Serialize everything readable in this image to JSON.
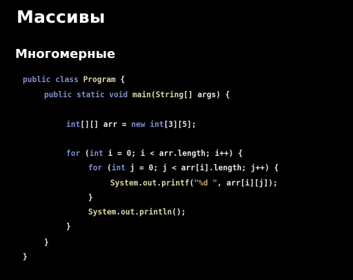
{
  "slide": {
    "title": "Массивы",
    "subtitle": "Многомерные"
  },
  "code": {
    "lines": [
      [
        [
          "kw",
          "public class "
        ],
        [
          "cls",
          "Program"
        ],
        [
          "plain",
          " {"
        ]
      ],
      [
        [
          "kw",
          "public static void "
        ],
        [
          "cls",
          "main"
        ],
        [
          "plain",
          "("
        ],
        [
          "cls",
          "String"
        ],
        [
          "plain",
          "[] args) {"
        ]
      ],
      [
        [
          "kw",
          "int"
        ],
        [
          "plain",
          "[][] arr = "
        ],
        [
          "kw",
          "new int"
        ],
        [
          "plain",
          "[3][5];"
        ]
      ],
      [
        [
          "kw",
          "for "
        ],
        [
          "plain",
          "("
        ],
        [
          "kw",
          "int "
        ],
        [
          "plain",
          "i = 0; i < arr.length; i++) {"
        ]
      ],
      [
        [
          "kw",
          "for "
        ],
        [
          "plain",
          "("
        ],
        [
          "kw",
          "int "
        ],
        [
          "plain",
          "j = 0; j < arr[i].length; j++) {"
        ]
      ],
      [
        [
          "cls",
          "System"
        ],
        [
          "plain",
          "."
        ],
        [
          "cls",
          "out"
        ],
        [
          "plain",
          "."
        ],
        [
          "cls",
          "printf"
        ],
        [
          "plain",
          "("
        ],
        [
          "str",
          "\"%d \""
        ],
        [
          "plain",
          ", arr[i][j]);"
        ]
      ],
      [
        [
          "plain",
          "}"
        ]
      ],
      [
        [
          "cls",
          "System"
        ],
        [
          "plain",
          "."
        ],
        [
          "cls",
          "out"
        ],
        [
          "plain",
          "."
        ],
        [
          "cls",
          "println"
        ],
        [
          "plain",
          "();"
        ]
      ],
      [
        [
          "plain",
          "}"
        ]
      ],
      [
        [
          "plain",
          "}"
        ]
      ],
      [
        [
          "plain",
          "}"
        ]
      ]
    ]
  },
  "colors": {
    "background": "#000000",
    "keyword": "#7f8fd0",
    "type": "#dcd6a8",
    "string": "#c9a06a",
    "text": "#e8e8e8"
  }
}
